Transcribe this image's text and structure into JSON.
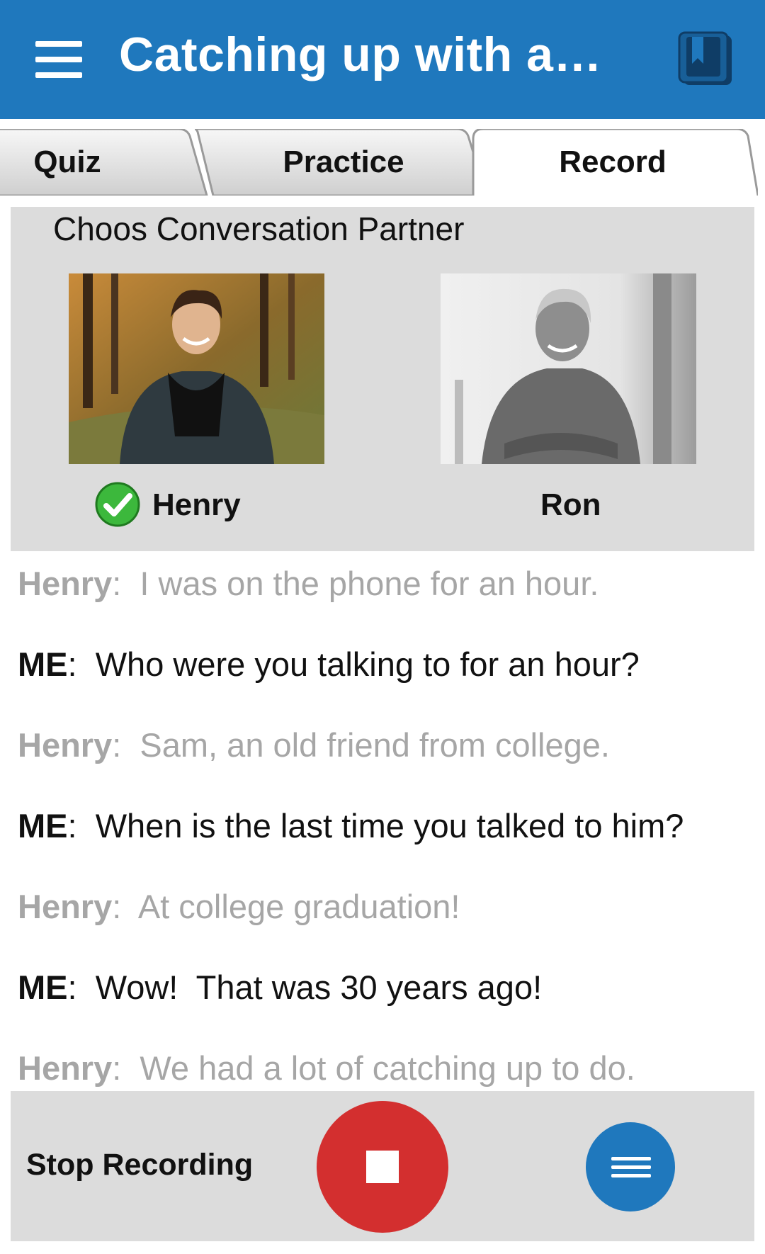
{
  "header": {
    "title": "Catching up with a…",
    "menu_icon": "hamburger-menu-icon",
    "book_icon": "book-icon"
  },
  "tabs": [
    {
      "label": "Quiz",
      "active": false
    },
    {
      "label": "Practice",
      "active": false
    },
    {
      "label": "Record",
      "active": true
    }
  ],
  "partner_section": {
    "heading": "Choos Conversation Partner",
    "partners": [
      {
        "name": "Henry",
        "selected": true
      },
      {
        "name": "Ron",
        "selected": false
      }
    ]
  },
  "transcript": [
    {
      "speaker": "Henry",
      "separator": ":",
      "text": "I was on the phone for an hour."
    },
    {
      "speaker": "ME",
      "separator": ":",
      "text": "Who were you talking to for an hour?"
    },
    {
      "speaker": "Henry",
      "separator": ":",
      "text": "Sam, an old friend from college."
    },
    {
      "speaker": "ME",
      "separator": ":",
      "text": "When is the last time you talked to him?"
    },
    {
      "speaker": "Henry",
      "separator": ":",
      "text": "At college graduation!"
    },
    {
      "speaker": "ME",
      "separator": ":",
      "text": "Wow!  That was 30 years ago!"
    },
    {
      "speaker": "Henry",
      "separator": ":",
      "text": "We had a lot of catching up to do."
    }
  ],
  "controls": {
    "stop_label": "Stop Recording",
    "record_icon": "stop-icon",
    "menu_icon": "menu-icon"
  },
  "colors": {
    "primary": "#1f78bd",
    "record": "#d32f2f",
    "panel": "#dcdcdc",
    "partner_text": "#a6a6a6",
    "check": "#3cb83c"
  }
}
